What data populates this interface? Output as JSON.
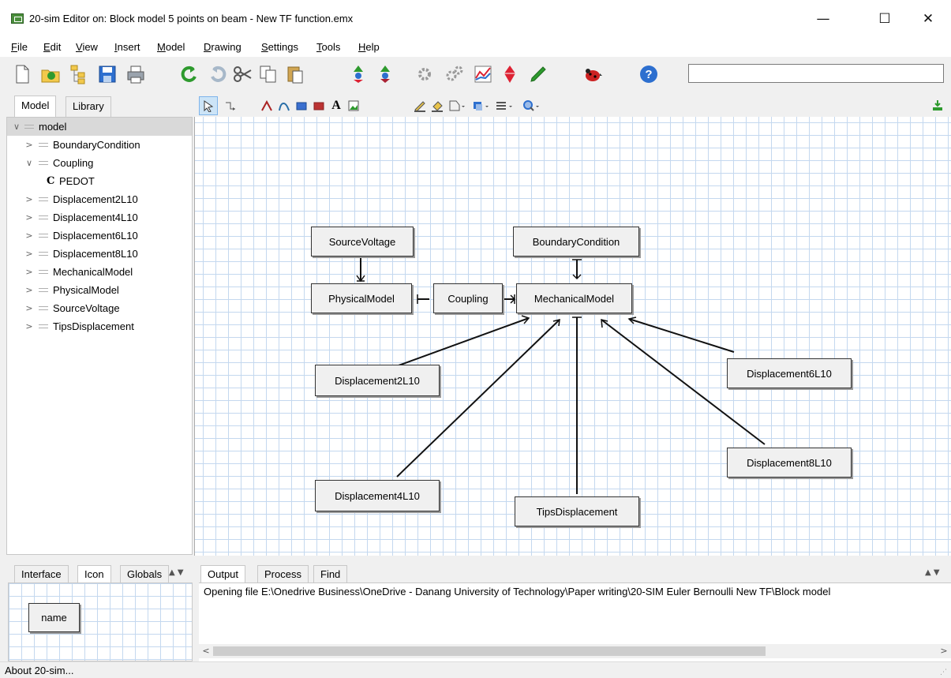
{
  "window": {
    "title": "20-sim Editor on: Block model 5 points on beam - New TF function.emx",
    "minimize": "—",
    "maximize": "☐",
    "close": "✕"
  },
  "menu": [
    {
      "label": "File",
      "key": "F",
      "rest": "ile"
    },
    {
      "label": "Edit",
      "key": "E",
      "rest": "dit"
    },
    {
      "label": "View",
      "key": "V",
      "rest": "iew"
    },
    {
      "label": "Insert",
      "key": "I",
      "rest": "nsert"
    },
    {
      "label": "Model",
      "key": "M",
      "rest": "odel"
    },
    {
      "label": "Drawing",
      "key": "D",
      "rest": "rawing"
    },
    {
      "label": "Settings",
      "key": "S",
      "rest": "ettings"
    },
    {
      "label": "Tools",
      "key": "T",
      "rest": "ools"
    },
    {
      "label": "Help",
      "key": "H",
      "rest": "elp"
    }
  ],
  "left_tabs": {
    "model": "Model",
    "library": "Library"
  },
  "tree": {
    "root": "model",
    "items": [
      {
        "label": "BoundaryCondition",
        "caret": ">"
      },
      {
        "label": "Coupling",
        "caret": "∨"
      },
      {
        "label": "PEDOT",
        "caret": "",
        "child": true,
        "icon": "C"
      },
      {
        "label": "Displacement2L10",
        "caret": ">"
      },
      {
        "label": "Displacement4L10",
        "caret": ">"
      },
      {
        "label": "Displacement6L10",
        "caret": ">"
      },
      {
        "label": "Displacement8L10",
        "caret": ">"
      },
      {
        "label": "MechanicalModel",
        "caret": ">"
      },
      {
        "label": "PhysicalModel",
        "caret": ">"
      },
      {
        "label": "SourceVoltage",
        "caret": ">"
      },
      {
        "label": "TipsDisplacement",
        "caret": ">"
      }
    ]
  },
  "canvas": {
    "blocks": {
      "source_voltage": "SourceVoltage",
      "boundary_condition": "BoundaryCondition",
      "physical_model": "PhysicalModel",
      "coupling": "Coupling",
      "mechanical_model": "MechanicalModel",
      "displacement2": "Displacement2L10",
      "displacement6": "Displacement6L10",
      "displacement8": "Displacement8L10",
      "displacement4": "Displacement4L10",
      "tips_displacement": "TipsDisplacement"
    }
  },
  "bottom_left_tabs": {
    "interface": "Interface",
    "icon": "Icon",
    "globals": "Globals"
  },
  "icon_pane": {
    "name_block": "name"
  },
  "bottom_tabs": {
    "output": "Output",
    "process": "Process",
    "find": "Find"
  },
  "output": {
    "text": "Opening file E:\\Onedrive Business\\OneDrive - Danang University of Technology\\Paper writing\\20-SIM Euler Bernoulli New TF\\Block model"
  },
  "status": {
    "text": "About 20-sim..."
  },
  "colors": {
    "grid": "#c4d8ef",
    "accent_green": "#2e9a2e",
    "selection": "#d9d9d9"
  }
}
